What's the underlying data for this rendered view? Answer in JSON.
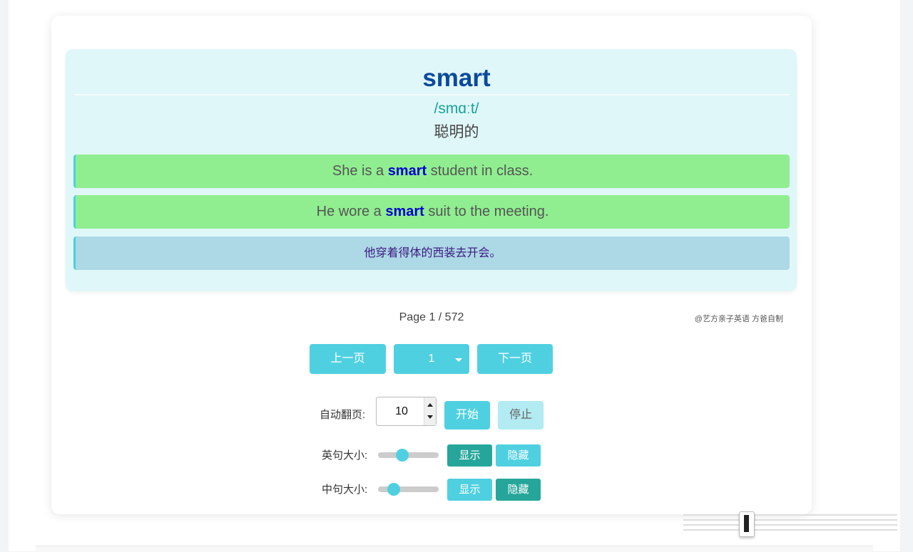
{
  "card": {
    "word": "smart",
    "phonetic": "/smɑːt/",
    "meaning": "聪明的",
    "sentences": [
      {
        "before": "She is a ",
        "keyword": "smart",
        "after": " student in class."
      },
      {
        "before": "He wore a ",
        "keyword": "smart",
        "after": " suit to the meeting."
      }
    ],
    "translation": "他穿着得体的西装去开会。"
  },
  "pager": {
    "info": "Page 1 / 572",
    "credit": "@艺方亲子英语 方爸自制",
    "prev_label": "上一页",
    "page_select_value": "1",
    "next_label": "下一页"
  },
  "autoplay": {
    "label": "自动翻页:",
    "interval_value": "10",
    "start_label": "开始",
    "stop_label": "停止"
  },
  "english_size": {
    "label": "英句大小:",
    "level": 0.38,
    "show_label": "显示",
    "hide_label": "隐藏",
    "active": "show"
  },
  "chinese_size": {
    "label": "中句大小:",
    "level": 0.2,
    "show_label": "显示",
    "hide_label": "隐藏",
    "active": "hide"
  },
  "colors": {
    "accent": "#4fd0e0",
    "accent_active": "#26a69a",
    "word": "#0b4a9c",
    "phonetic": "#17a398",
    "sentence_bg": "#90ee90",
    "translation_bg": "#add8e6"
  }
}
